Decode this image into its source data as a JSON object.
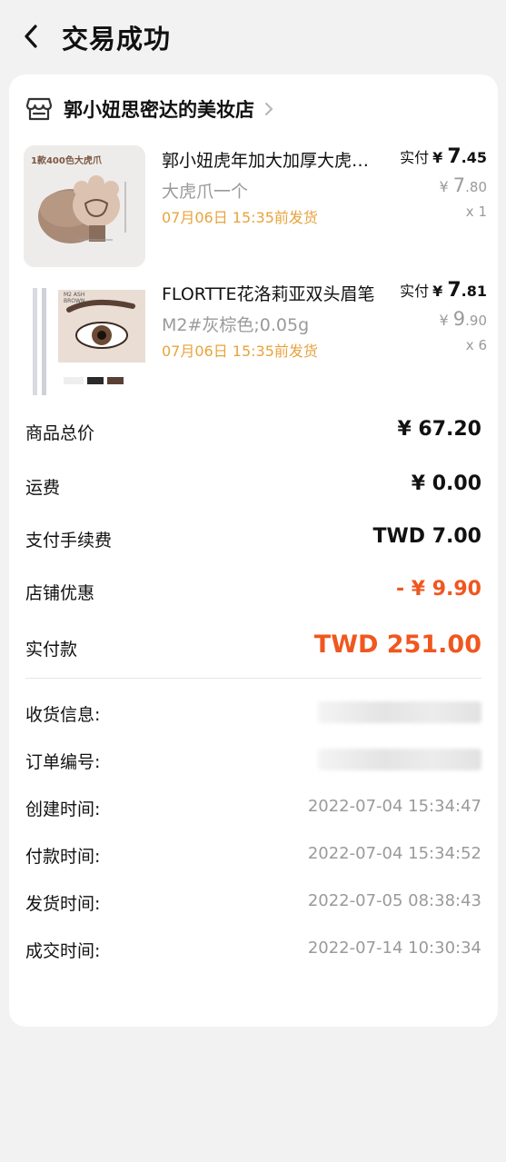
{
  "header": {
    "title": "交易成功"
  },
  "shop": {
    "name": "郭小妞思密达的美妆店"
  },
  "items": [
    {
      "title": "郭小妞虎年加大加厚大虎爪美妆蛋",
      "spec": "大虎爪一个",
      "ship": "07月06日 15:35前发货",
      "actual_label": "实付",
      "actual_currency": "¥",
      "actual_int": "7",
      "actual_dec": ".45",
      "orig_currency": "¥",
      "orig_int": "7",
      "orig_dec": ".80",
      "qty": "x 1",
      "thumb_caption": "1款400色大虎爪"
    },
    {
      "title": "FLORTTE花洛莉亚双头眉笔",
      "spec": "M2#灰棕色;0.05g",
      "ship": "07月06日 15:35前发货",
      "actual_label": "实付",
      "actual_currency": "¥",
      "actual_int": "7",
      "actual_dec": ".81",
      "orig_currency": "¥",
      "orig_int": "9",
      "orig_dec": ".90",
      "qty": "x 6",
      "thumb_caption": "M2 ASH BROWN"
    }
  ],
  "summary": {
    "goods_total_label": "商品总价",
    "goods_total": "¥ 67.20",
    "shipping_label": "运费",
    "shipping": "¥ 0.00",
    "fee_label": "支付手续费",
    "fee": "TWD 7.00",
    "discount_label": "店铺优惠",
    "discount": "- ¥ 9.90",
    "paid_label": "实付款",
    "paid": "TWD 251.00"
  },
  "info": {
    "address_label": "收货信息:",
    "order_no_label": "订单编号:",
    "created_label": "创建时间:",
    "created": "2022-07-04 15:34:47",
    "paid_time_label": "付款时间:",
    "paid_time": "2022-07-04 15:34:52",
    "shipped_label": "发货时间:",
    "shipped": "2022-07-05 08:38:43",
    "closed_label": "成交时间:",
    "closed": "2022-07-14 10:30:34"
  },
  "colors": {
    "accent_orange": "#f0571f",
    "ship_yellow": "#e8a33d",
    "muted": "#9a9a9a",
    "background": "#f2f2f2"
  }
}
